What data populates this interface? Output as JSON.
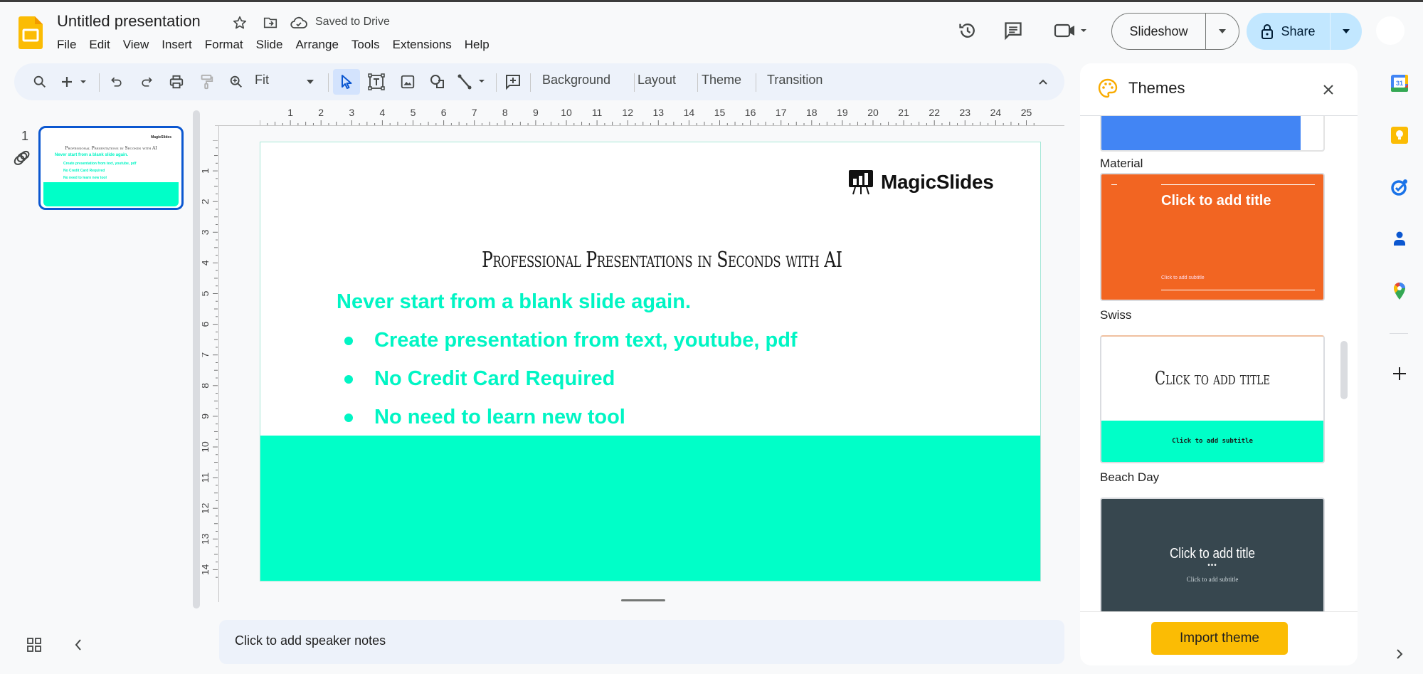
{
  "app": {
    "doc_title": "Untitled presentation",
    "save_status": "Saved to Drive",
    "icons": {
      "logo": "google-slides-logo",
      "star": "star-icon",
      "move": "move-to-folder-icon",
      "cloud": "cloud-saved-icon"
    }
  },
  "menu": [
    "File",
    "Edit",
    "View",
    "Insert",
    "Format",
    "Slide",
    "Arrange",
    "Tools",
    "Extensions",
    "Help"
  ],
  "header_right": {
    "history_icon": "version-history-icon",
    "comments_icon": "comments-icon",
    "meet_icon": "meet-camera-icon",
    "slideshow_label": "Slideshow",
    "share_label": "Share"
  },
  "toolbar": {
    "zoom_value": "Fit",
    "background_label": "Background",
    "layout_label": "Layout",
    "theme_label": "Theme",
    "transition_label": "Transition"
  },
  "filmstrip": {
    "slide_number": "1",
    "thumbnail": {
      "logo": "MagicSlides",
      "title": "Professional Presentations in Seconds with AI",
      "subtitle": "Never start from a blank slide again.",
      "bullets": [
        "Create presentation from text, youtube, pdf",
        "No Credit Card Required",
        "No need to learn new tool"
      ]
    }
  },
  "rulers": {
    "horizontal": [
      "1",
      "2",
      "3",
      "4",
      "5",
      "6",
      "7",
      "8",
      "9",
      "10",
      "11",
      "12",
      "13",
      "14",
      "15",
      "16",
      "17",
      "18",
      "19",
      "20",
      "21",
      "22",
      "23",
      "24",
      "25"
    ],
    "vertical": [
      "1",
      "2",
      "3",
      "4",
      "5",
      "6",
      "7",
      "8",
      "9",
      "10",
      "11",
      "12",
      "13",
      "14"
    ]
  },
  "slide": {
    "logo_text": "MagicSlides",
    "title": "Professional Presentations in Seconds with AI",
    "subtitle": "Never start from a blank slide again.",
    "bullets": [
      "Create presentation from text, youtube, pdf",
      "No Credit Card Required",
      "No need to learn new tool"
    ],
    "accent_color": "#00ffc8",
    "text_accent_color": "#00f5c4"
  },
  "notes": {
    "placeholder": "Click to add speaker notes"
  },
  "themes_panel": {
    "title": "Themes",
    "themes": [
      {
        "name": "Material",
        "color": "#4285f4"
      },
      {
        "name": "Swiss",
        "title": "Click to add title",
        "subtitle": "Click to add subtitle",
        "color": "#f26522"
      },
      {
        "name": "Beach Day",
        "title": "Click to add title",
        "subtitle": "Click to add subtitle",
        "color": "#00ffc8"
      },
      {
        "name": "",
        "title": "Click to add title",
        "subtitle": "Click to add subtitle",
        "color": "#37474f"
      }
    ],
    "import_label": "Import theme"
  },
  "side_rail": [
    "calendar-icon",
    "keep-icon",
    "tasks-icon",
    "contacts-icon",
    "maps-icon",
    "add-addon-icon"
  ]
}
